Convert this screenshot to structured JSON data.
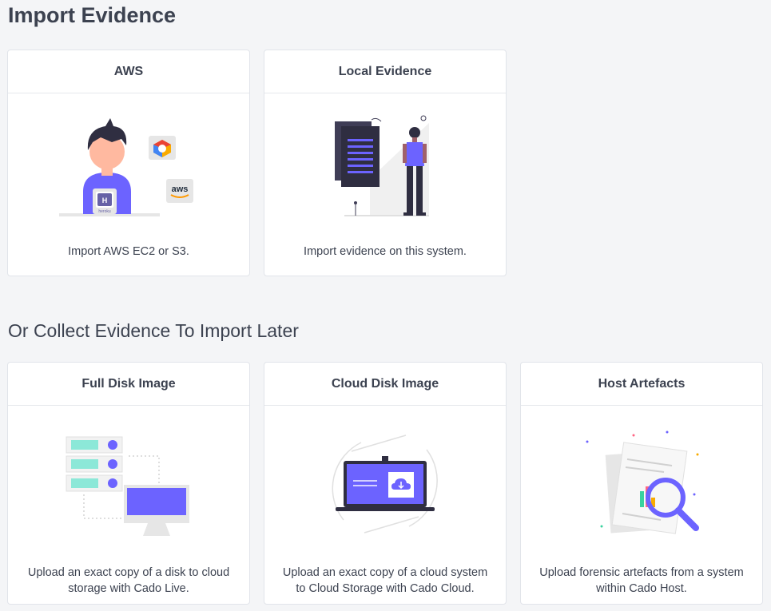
{
  "page": {
    "title": "Import Evidence",
    "subtitle": "Or Collect Evidence To Import Later"
  },
  "import_cards": [
    {
      "title": "AWS",
      "description": "Import AWS EC2 or S3.",
      "illustration": "person-laptop-cloud-logos"
    },
    {
      "title": "Local Evidence",
      "description": "Import evidence on this system.",
      "illustration": "person-standing-document"
    }
  ],
  "collect_cards": [
    {
      "title": "Full Disk Image",
      "description": "Upload an exact copy of a disk to cloud storage with Cado Live.",
      "illustration": "servers-monitor"
    },
    {
      "title": "Cloud Disk Image",
      "description": "Upload an exact copy of a cloud system to Cloud Storage with Cado Cloud.",
      "illustration": "laptop-cloud-upload"
    },
    {
      "title": "Host Artefacts",
      "description": "Upload forensic artefacts from a system within Cado Host.",
      "illustration": "documents-magnifier"
    }
  ],
  "logos": {
    "aws_text": "aws",
    "heroku_text": "heroku"
  },
  "colors": {
    "accent": "#6c63ff",
    "text": "#3c4250",
    "background": "#f4f5f7",
    "card": "#ffffff"
  }
}
